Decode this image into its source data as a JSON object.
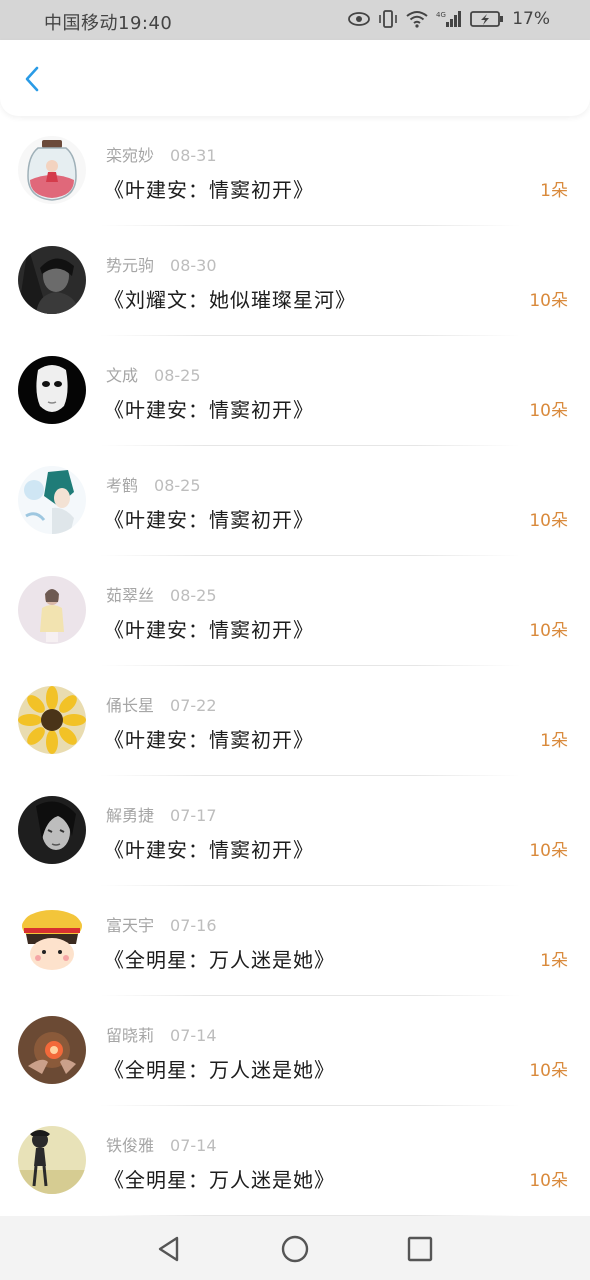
{
  "status_bar": {
    "carrier_time": "中国移动19:40",
    "battery_percent": "17%",
    "icons": [
      "eye-icon",
      "vibrate-icon",
      "wifi-icon",
      "signal-4g-icon",
      "battery-charging-icon"
    ]
  },
  "header": {
    "back_icon": "chevron-left-icon",
    "accent_color": "#2a9be6"
  },
  "list": {
    "items": [
      {
        "name": "栾宛妙",
        "date": "08-31",
        "title": "《叶建安：情窦初开》",
        "amount": "1朵",
        "avatar": "jar-avatar"
      },
      {
        "name": "势元驹",
        "date": "08-30",
        "title": "《刘耀文：她似璀璨星河》",
        "amount": "10朵",
        "avatar": "dark-portrait-avatar"
      },
      {
        "name": "文成",
        "date": "08-25",
        "title": "《叶建安：情窦初开》",
        "amount": "10朵",
        "avatar": "mask-avatar"
      },
      {
        "name": "考鹤",
        "date": "08-25",
        "title": "《叶建安：情窦初开》",
        "amount": "10朵",
        "avatar": "anime-avatar"
      },
      {
        "name": "茹翠丝",
        "date": "08-25",
        "title": "《叶建安：情窦初开》",
        "amount": "10朵",
        "avatar": "girl-avatar"
      },
      {
        "name": "俑长星",
        "date": "07-22",
        "title": "《叶建安：情窦初开》",
        "amount": "1朵",
        "avatar": "sunflower-avatar"
      },
      {
        "name": "解勇捷",
        "date": "07-17",
        "title": "《叶建安：情窦初开》",
        "amount": "10朵",
        "avatar": "bw-portrait-avatar"
      },
      {
        "name": "富天宇",
        "date": "07-16",
        "title": "《全明星：万人迷是她》",
        "amount": "1朵",
        "avatar": "cartoon-girl-avatar"
      },
      {
        "name": "留晓莉",
        "date": "07-14",
        "title": "《全明星：万人迷是她》",
        "amount": "10朵",
        "avatar": "glow-hands-avatar"
      },
      {
        "name": "铁俊雅",
        "date": "07-14",
        "title": "《全明星：万人迷是她》",
        "amount": "10朵",
        "avatar": "silhouette-avatar"
      }
    ]
  },
  "nav_bar": {
    "icons": [
      "back-triangle-icon",
      "home-circle-icon",
      "recents-square-icon"
    ]
  },
  "colors": {
    "amount": "#d98a3c",
    "meta": "#a6a6a6",
    "title": "#1d1d1d",
    "status_bar_bg": "#d6d6d6",
    "nav_bar_bg": "#f3f3f3"
  }
}
